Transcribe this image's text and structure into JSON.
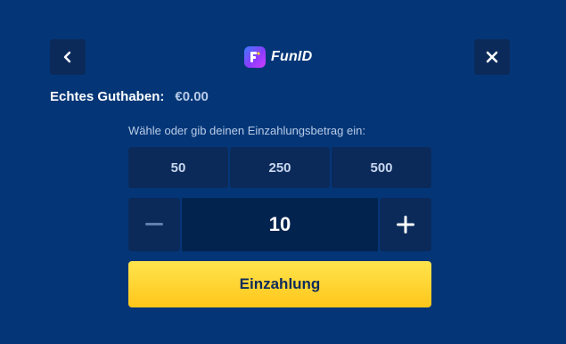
{
  "header": {
    "back_icon": "chevron-left-icon",
    "close_icon": "close-icon",
    "brand_name": "FunID",
    "brand_logo_icon": "funid-logo-icon"
  },
  "balance": {
    "label": "Echtes Guthaben:",
    "value": "€0.00"
  },
  "deposit": {
    "prompt": "Wähle oder gib deinen Einzahlungsbetrag ein:",
    "presets": [
      "50",
      "250",
      "500"
    ],
    "amount": "10",
    "decrement_icon": "minus-icon",
    "increment_icon": "plus-icon",
    "submit_label": "Einzahlung"
  },
  "colors": {
    "background": "#043677",
    "panel": "#0b2a5a",
    "button_yellow": "#ffd22e",
    "button_text": "#0d2c5c"
  }
}
